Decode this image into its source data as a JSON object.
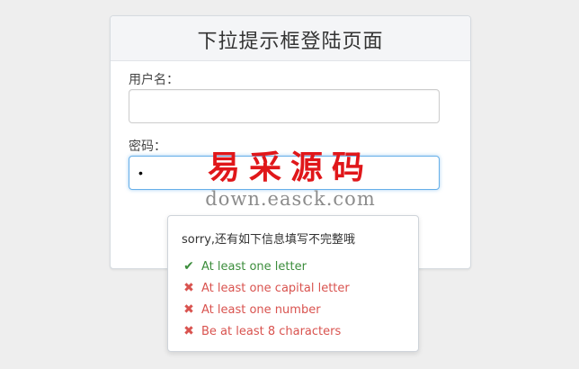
{
  "login": {
    "title": "下拉提示框登陆页面",
    "username": {
      "label": "用户名：",
      "value": ""
    },
    "password": {
      "label": "密码：",
      "value": "•"
    }
  },
  "watermark": {
    "chinese": "易采源码",
    "url": "down.easck.com"
  },
  "popover": {
    "title": "sorry,还有如下信息填写不完整哦",
    "rules": [
      {
        "label": "At least one letter",
        "status": "ok",
        "icon": "checkmark-icon"
      },
      {
        "label": "At least one capital letter",
        "status": "bad",
        "icon": "cross-icon"
      },
      {
        "label": "At least one number",
        "status": "bad",
        "icon": "cross-icon"
      },
      {
        "label": "Be at least 8 characters",
        "status": "bad",
        "icon": "cross-icon"
      }
    ]
  },
  "colors": {
    "ok": "#3c8d3c",
    "bad": "#d9534f",
    "focus": "#66afe9"
  }
}
